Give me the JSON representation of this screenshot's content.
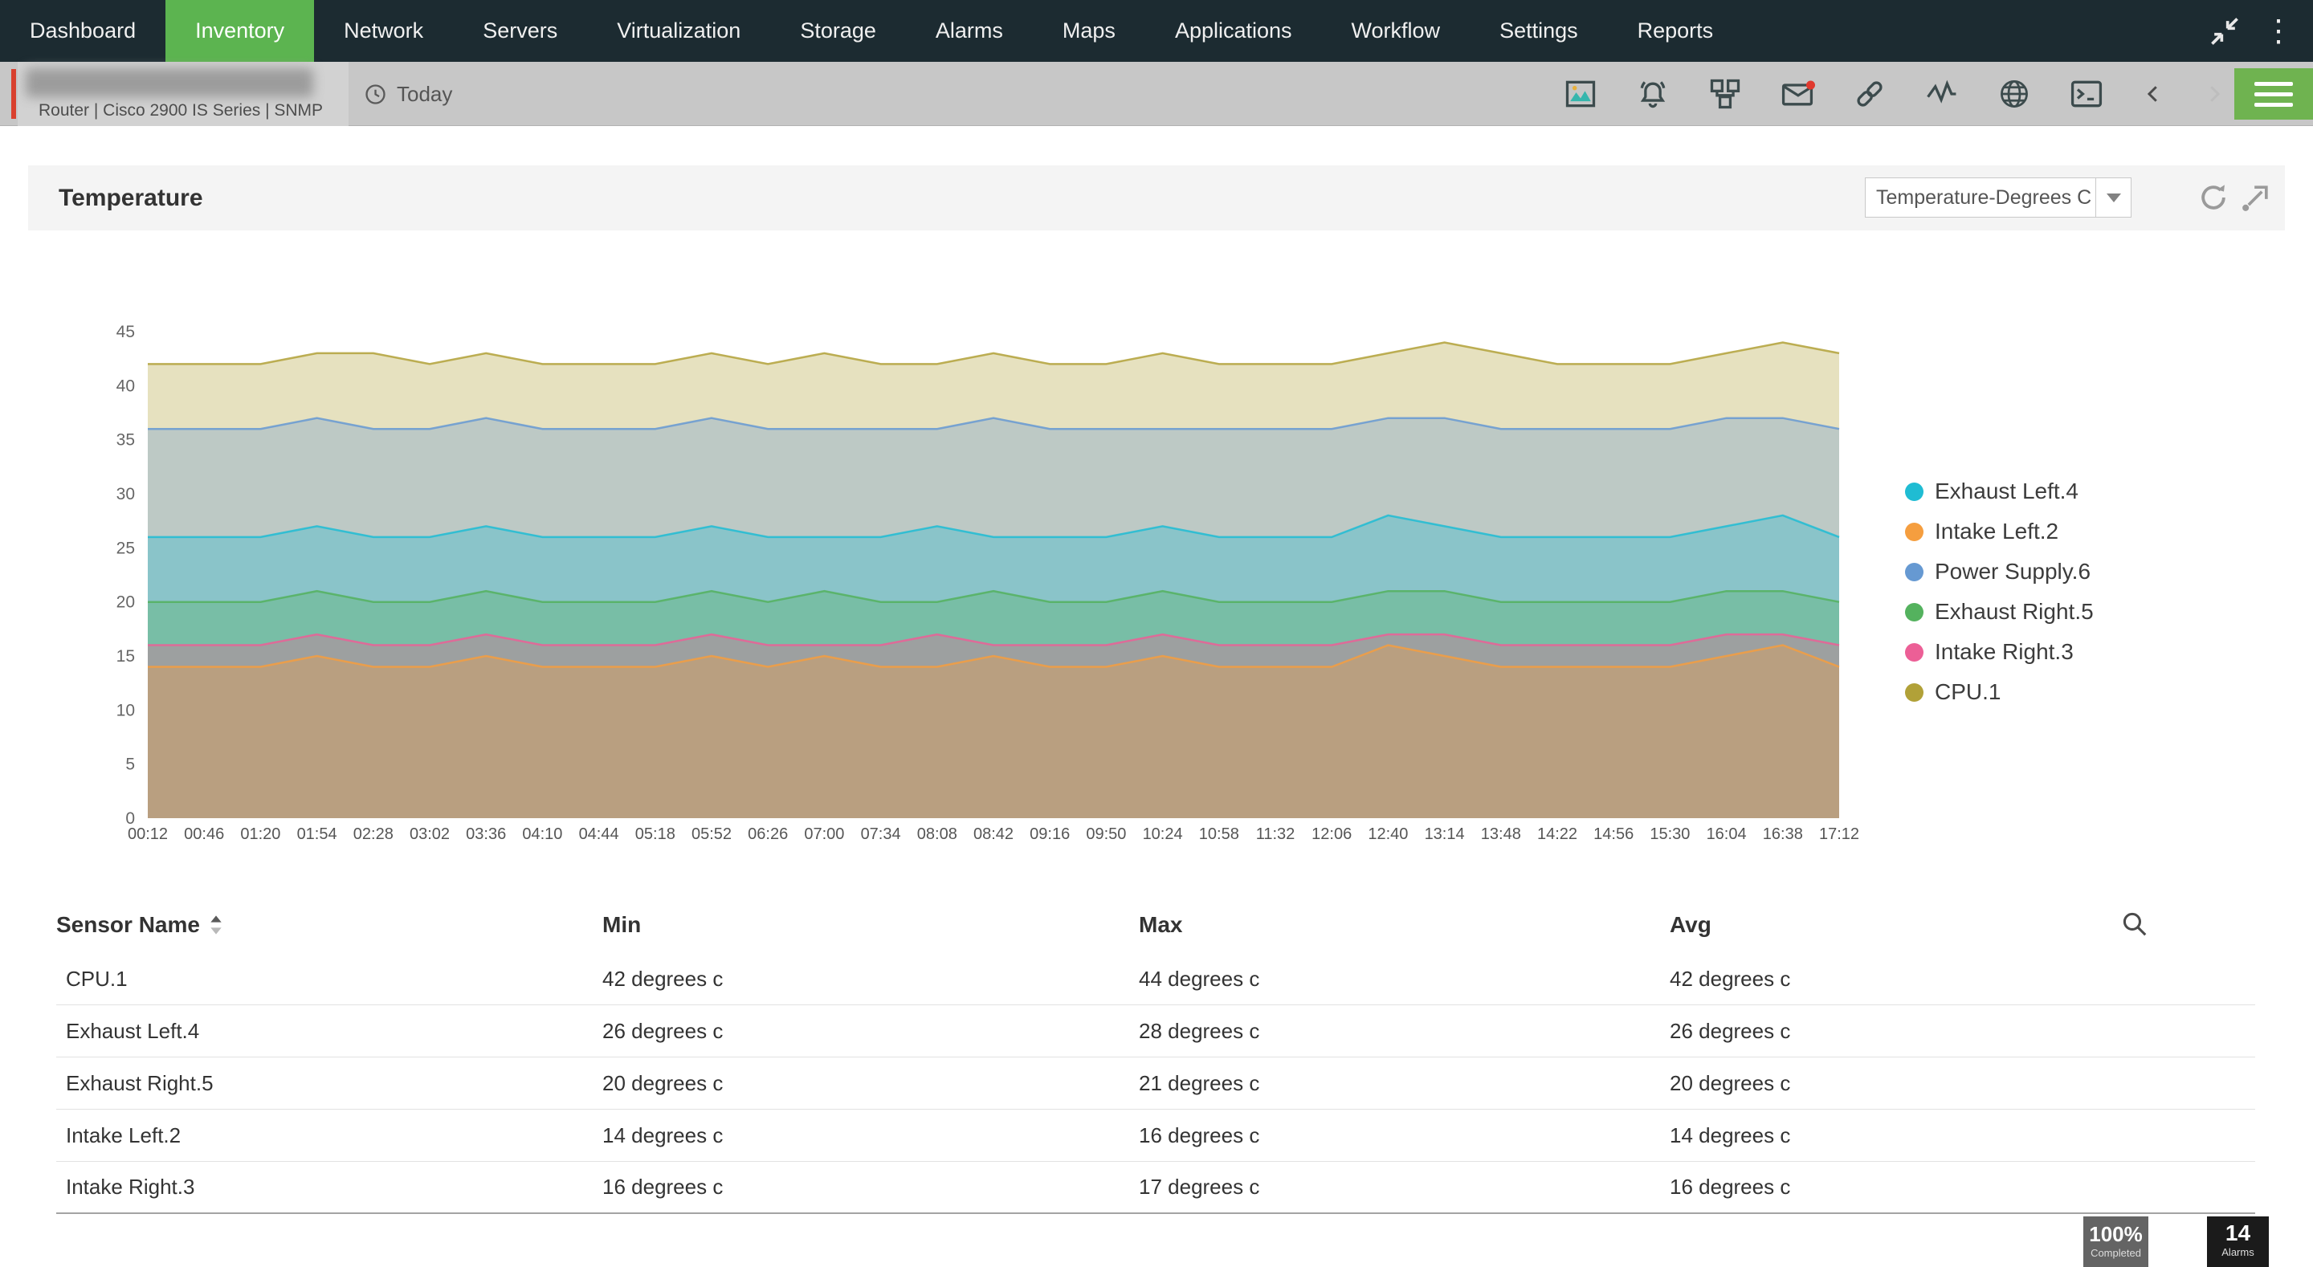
{
  "nav": {
    "items": [
      "Dashboard",
      "Inventory",
      "Network",
      "Servers",
      "Virtualization",
      "Storage",
      "Alarms",
      "Maps",
      "Applications",
      "Workflow",
      "Settings",
      "Reports"
    ],
    "active": "Inventory"
  },
  "device_bar": {
    "device_type": "Router | Cisco 2900 IS Series | SNMP",
    "time_filter": "Today",
    "toolbar_icons": [
      "chart-image-icon",
      "alarm-bell-icon",
      "discovery-boxes-icon",
      "mail-icon",
      "link-icon",
      "sparkline-icon",
      "globe-icon",
      "terminal-icon",
      "chevron-left-icon",
      "chevron-right-icon",
      "menu-icon"
    ]
  },
  "panel": {
    "title": "Temperature",
    "metric_dropdown": "Temperature-Degrees C"
  },
  "chart_data": {
    "type": "area",
    "title": "Temperature",
    "xlabel": "",
    "ylabel": "",
    "ylim": [
      0,
      45
    ],
    "yticks": [
      0,
      5,
      10,
      15,
      20,
      25,
      30,
      35,
      40,
      45
    ],
    "grid": false,
    "legend_position": "right",
    "x": [
      "00:12",
      "00:46",
      "01:20",
      "01:54",
      "02:28",
      "03:02",
      "03:36",
      "04:10",
      "04:44",
      "05:18",
      "05:52",
      "06:26",
      "07:00",
      "07:34",
      "08:08",
      "08:42",
      "09:16",
      "09:50",
      "10:24",
      "10:58",
      "11:32",
      "12:06",
      "12:40",
      "13:14",
      "13:48",
      "14:22",
      "14:56",
      "15:30",
      "16:04",
      "16:38",
      "17:12"
    ],
    "series": [
      {
        "name": "Exhaust Left.4",
        "color": "#1fbcd3",
        "values": [
          26,
          26,
          26,
          27,
          26,
          26,
          27,
          26,
          26,
          26,
          27,
          26,
          26,
          26,
          27,
          26,
          26,
          26,
          27,
          26,
          26,
          26,
          28,
          27,
          26,
          26,
          26,
          26,
          27,
          28,
          26
        ]
      },
      {
        "name": "Intake Left.2",
        "color": "#f59e3f",
        "values": [
          14,
          14,
          14,
          15,
          14,
          14,
          15,
          14,
          14,
          14,
          15,
          14,
          15,
          14,
          14,
          15,
          14,
          14,
          15,
          14,
          14,
          14,
          16,
          15,
          14,
          14,
          14,
          14,
          15,
          16,
          14
        ]
      },
      {
        "name": "Power Supply.6",
        "color": "#6699d2",
        "values": [
          36,
          36,
          36,
          37,
          36,
          36,
          37,
          36,
          36,
          36,
          37,
          36,
          36,
          36,
          36,
          37,
          36,
          36,
          36,
          36,
          36,
          36,
          37,
          37,
          36,
          36,
          36,
          36,
          37,
          37,
          36
        ]
      },
      {
        "name": "Exhaust Right.5",
        "color": "#54b25e",
        "values": [
          20,
          20,
          20,
          21,
          20,
          20,
          21,
          20,
          20,
          20,
          21,
          20,
          21,
          20,
          20,
          21,
          20,
          20,
          21,
          20,
          20,
          20,
          21,
          21,
          20,
          20,
          20,
          20,
          21,
          21,
          20
        ]
      },
      {
        "name": "Intake Right.3",
        "color": "#ec5f96",
        "values": [
          16,
          16,
          16,
          17,
          16,
          16,
          17,
          16,
          16,
          16,
          17,
          16,
          16,
          16,
          17,
          16,
          16,
          16,
          17,
          16,
          16,
          16,
          17,
          17,
          16,
          16,
          16,
          16,
          17,
          17,
          16
        ]
      },
      {
        "name": "CPU.1",
        "color": "#b1a138",
        "values": [
          42,
          42,
          42,
          43,
          43,
          42,
          43,
          42,
          42,
          42,
          43,
          42,
          43,
          42,
          42,
          43,
          42,
          42,
          43,
          42,
          42,
          42,
          43,
          44,
          43,
          42,
          42,
          42,
          43,
          44,
          43
        ]
      }
    ]
  },
  "table": {
    "headers": [
      "Sensor Name",
      "Min",
      "Max",
      "Avg"
    ],
    "rows": [
      {
        "name": "CPU.1",
        "min": "42 degrees c",
        "max": "44 degrees c",
        "avg": "42 degrees c"
      },
      {
        "name": "Exhaust Left.4",
        "min": "26 degrees c",
        "max": "28 degrees c",
        "avg": "26 degrees c"
      },
      {
        "name": "Exhaust Right.5",
        "min": "20 degrees c",
        "max": "21 degrees c",
        "avg": "20 degrees c"
      },
      {
        "name": "Intake Left.2",
        "min": "14 degrees c",
        "max": "16 degrees c",
        "avg": "14 degrees c"
      },
      {
        "name": "Intake Right.3",
        "min": "16 degrees c",
        "max": "17 degrees c",
        "avg": "16 degrees c"
      }
    ]
  },
  "status_badges": {
    "progress_value": "100%",
    "progress_label": "Completed",
    "alarm_count": "14",
    "alarm_label": "Alarms"
  }
}
